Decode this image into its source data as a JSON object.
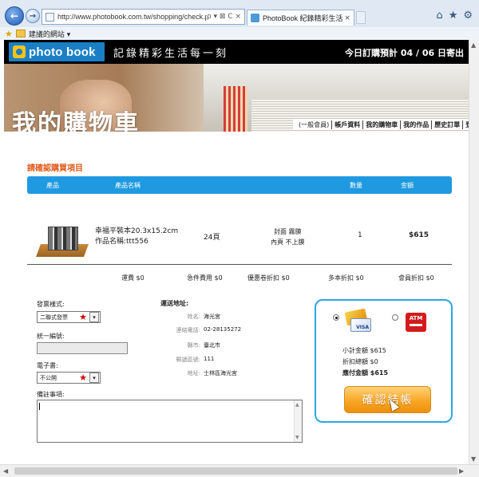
{
  "browser": {
    "url": "http://www.photobook.com.tw/shopping/check.php",
    "tab_title": "PhotoBook 紀錄精彩生活...",
    "favorites_label": "建議的網站 ▾",
    "address_controls": "ρ ▾ ⊠ C ×"
  },
  "header": {
    "logo_text": "photo book",
    "slogan": "記錄精彩生活每一刻",
    "shipping_notice": "今日訂購預計 04 / 06 日寄出"
  },
  "hero": {
    "title": "我的購物車",
    "nav": [
      "(一般會員)",
      "帳戶資料",
      "我的購物車",
      "我的作品",
      "歷史訂單",
      "登"
    ]
  },
  "cart": {
    "section_title": "請確認購買項目",
    "columns": {
      "product": "產品",
      "product_name": "產品名稱",
      "quantity": "數量",
      "amount": "金額"
    },
    "item": {
      "name_line1": "幸福平裝本20.3x15.2cm",
      "name_line2": "作品名稱:ttt556",
      "pages": "24頁",
      "cover_line1": "封面 霧膜",
      "cover_line2": "內頁 不上膜",
      "quantity": "1",
      "price": "$615"
    },
    "fees": {
      "shipping": "運費 $0",
      "rush": "急件費用 $0",
      "coupon": "優惠卷折扣 $0",
      "multi": "多本折扣 $0",
      "member": "會員折扣 $0"
    }
  },
  "form": {
    "invoice_type_label": "發票樣式:",
    "invoice_type_value": "二聯式發票",
    "tax_id_label": "統一編號:",
    "ebook_label": "電子書:",
    "ebook_value": "不公開",
    "notes_label": "備註事項:",
    "required_mark": "★",
    "dropdown_arrow": "▾"
  },
  "shipping_address": {
    "title": "運送地址:",
    "rows": [
      {
        "key": "姓名:",
        "value": "海光宮"
      },
      {
        "key": "連絡電話:",
        "value": "02-28135272"
      },
      {
        "key": "縣市:",
        "value": "臺北市"
      },
      {
        "key": "郵遞區號:",
        "value": "111"
      },
      {
        "key": "地址:",
        "value": "士林區海光宮"
      }
    ]
  },
  "payment": {
    "card_label": "VISA",
    "atm_label": "ATM",
    "subtotal": "小計金額 $615",
    "discount_total": "折扣總額 $0",
    "total": "應付金額 $615",
    "checkout_label": "確認結帳"
  },
  "colors": {
    "accent_blue": "#1f9ae0",
    "title_orange": "#e05a1a",
    "checkout_orange": "#f7a726",
    "atm_red": "#d41b1b"
  }
}
